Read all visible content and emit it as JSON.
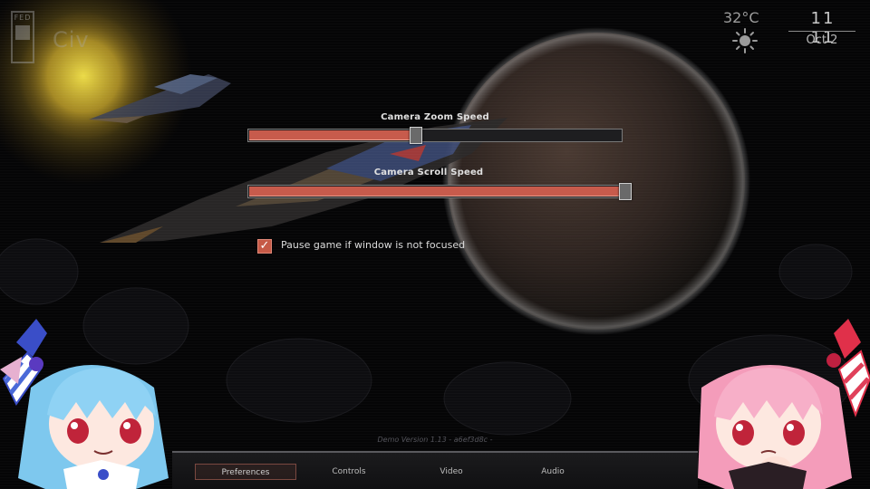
{
  "header": {
    "logo_text": "FED",
    "logo_word": "Civ",
    "temperature": "32°C",
    "weather_icon": "sun-icon",
    "time": "11 11",
    "date": "Oct 2"
  },
  "settings": {
    "camera_zoom": {
      "label": "Camera Zoom Speed",
      "value_fraction": 0.45
    },
    "camera_scroll": {
      "label": "Camera Scroll Speed",
      "value_fraction": 1.0
    },
    "pause_checkbox": {
      "label": "Pause game if window is not focused",
      "checked": true
    }
  },
  "version_text": "Demo Version 1.13 - a6ef3d8c -",
  "tabs": [
    {
      "label": "Preferences",
      "active": true
    },
    {
      "label": "Controls",
      "active": false
    },
    {
      "label": "Video",
      "active": false
    },
    {
      "label": "Audio",
      "active": false
    }
  ],
  "colors": {
    "accent": "#c75b4c",
    "background": "#050506",
    "planet": "#3a2a24"
  }
}
